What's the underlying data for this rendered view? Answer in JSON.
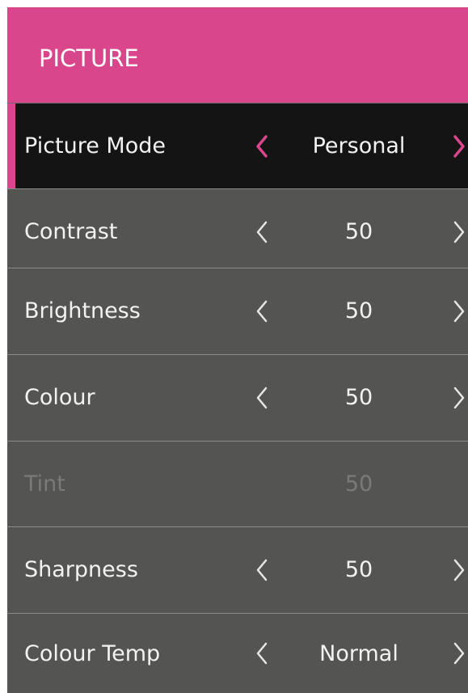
{
  "menu": {
    "title": "PICTURE",
    "colors": {
      "accent": "#d9468b",
      "panel": "#545553",
      "selected_row": "#141414",
      "text": "#f2f2f2",
      "disabled_text": "#7a7a79"
    },
    "items": [
      {
        "label": "Picture Mode",
        "value": "Personal",
        "selected": true,
        "enabled": true
      },
      {
        "label": "Contrast",
        "value": "50",
        "selected": false,
        "enabled": true
      },
      {
        "label": "Brightness",
        "value": "50",
        "selected": false,
        "enabled": true
      },
      {
        "label": "Colour",
        "value": "50",
        "selected": false,
        "enabled": true
      },
      {
        "label": "Tint",
        "value": "50",
        "selected": false,
        "enabled": false
      },
      {
        "label": "Sharpness",
        "value": "50",
        "selected": false,
        "enabled": true
      },
      {
        "label": "Colour Temp",
        "value": "Normal",
        "selected": false,
        "enabled": true
      }
    ],
    "icons": {
      "previous": "chevron-left-icon",
      "next": "chevron-right-icon"
    }
  }
}
